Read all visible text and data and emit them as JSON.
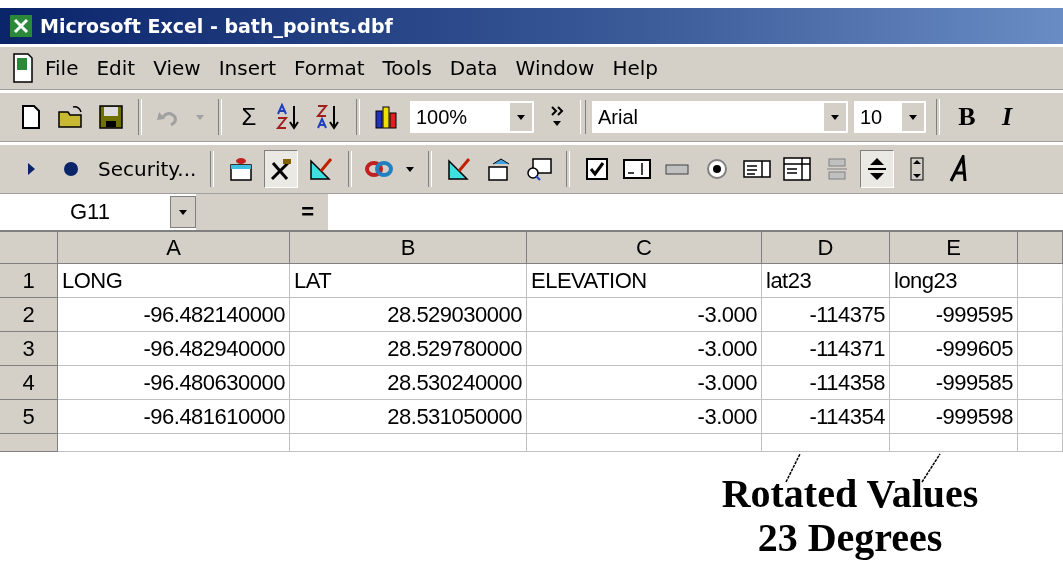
{
  "window": {
    "title": "Microsoft Excel - bath_points.dbf"
  },
  "menu": [
    "File",
    "Edit",
    "View",
    "Insert",
    "Format",
    "Tools",
    "Data",
    "Window",
    "Help"
  ],
  "toolbar_standard": [
    {
      "kind": "new"
    },
    {
      "kind": "open"
    },
    {
      "kind": "save"
    },
    {
      "kind": "sep"
    },
    {
      "kind": "undo",
      "disabled": true
    },
    {
      "kind": "caret",
      "disabled": true
    },
    {
      "kind": "sep"
    },
    {
      "kind": "text",
      "text": "Σ"
    },
    {
      "kind": "sort-asc"
    },
    {
      "kind": "sort-desc"
    },
    {
      "kind": "sep"
    },
    {
      "kind": "chart"
    },
    {
      "kind": "combo",
      "text": "100%",
      "wide": false
    },
    {
      "kind": "more"
    },
    {
      "kind": "grip"
    },
    {
      "kind": "combo",
      "text": "Arial",
      "wide": true
    },
    {
      "kind": "combo",
      "text": "10",
      "wide": false
    },
    {
      "kind": "sep"
    },
    {
      "kind": "bold",
      "text": "B"
    },
    {
      "kind": "italic",
      "text": "I"
    }
  ],
  "toolbar_controls": [
    {
      "kind": "run"
    },
    {
      "kind": "record"
    },
    {
      "kind": "label",
      "text": "Security..."
    },
    {
      "kind": "sep"
    },
    {
      "kind": "toolbox",
      "pressed": false
    },
    {
      "kind": "design",
      "pressed": true
    },
    {
      "kind": "ruler",
      "pressed": false
    },
    {
      "kind": "sep"
    },
    {
      "kind": "link",
      "pressed": false
    },
    {
      "kind": "caret"
    },
    {
      "kind": "sep"
    },
    {
      "kind": "ruler",
      "pressed": false
    },
    {
      "kind": "properties",
      "pressed": false
    },
    {
      "kind": "viewcode",
      "pressed": false
    },
    {
      "kind": "sep"
    },
    {
      "kind": "checkbox",
      "pressed": false
    },
    {
      "kind": "textbox",
      "pressed": false
    },
    {
      "kind": "cmdbutton",
      "pressed": false
    },
    {
      "kind": "radio",
      "pressed": false
    },
    {
      "kind": "listbox",
      "pressed": false
    },
    {
      "kind": "combobox",
      "pressed": false
    },
    {
      "kind": "toggle",
      "pressed": false
    },
    {
      "kind": "spin",
      "pressed": true
    },
    {
      "kind": "scroll",
      "pressed": false
    },
    {
      "kind": "labelctl",
      "pressed": false
    }
  ],
  "formula_bar": {
    "name_box": "G11",
    "equals": "="
  },
  "sheet": {
    "columns": [
      "A",
      "B",
      "C",
      "D",
      "E"
    ],
    "rows": [
      {
        "number": "1",
        "cells": [
          "LONG",
          "LAT",
          "ELEVATION",
          "lat23",
          "long23"
        ]
      },
      {
        "number": "2",
        "cells": [
          "-96.482140000",
          "28.529030000",
          "-3.000",
          "-114375",
          "-999595"
        ]
      },
      {
        "number": "3",
        "cells": [
          "-96.482940000",
          "28.529780000",
          "-3.000",
          "-114371",
          "-999605"
        ]
      },
      {
        "number": "4",
        "cells": [
          "-96.480630000",
          "28.530240000",
          "-3.000",
          "-114358",
          "-999585"
        ]
      },
      {
        "number": "5",
        "cells": [
          "-96.481610000",
          "28.531050000",
          "-3.000",
          "-114354",
          "-999598"
        ]
      }
    ]
  },
  "annotation": {
    "lines": [
      "Rotated Values",
      "23 Degrees"
    ]
  }
}
